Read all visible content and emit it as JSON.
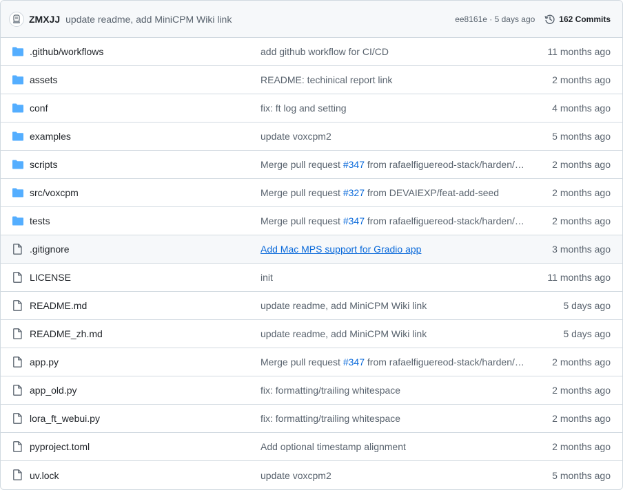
{
  "latest_commit": {
    "author": "ZMXJJ",
    "message": "update readme, add MiniCPM Wiki link",
    "sha_time": "ee8161e · 5 days ago",
    "commits_label": "162 Commits"
  },
  "colors": {
    "folder": "#54aeff",
    "link": "#0969da",
    "muted": "#59636e",
    "border": "#d1d9e0",
    "header_bg": "#f6f8fa"
  },
  "rows": [
    {
      "type": "folder",
      "name": ".github/workflows",
      "msg_pre": "add github workflow for CI/CD",
      "pr": "",
      "msg_post": "",
      "time": "11 months ago"
    },
    {
      "type": "folder",
      "name": "assets",
      "msg_pre": "README: techinical report link",
      "pr": "",
      "msg_post": "",
      "time": "2 months ago"
    },
    {
      "type": "folder",
      "name": "conf",
      "msg_pre": "fix: ft log and setting",
      "pr": "",
      "msg_post": "",
      "time": "4 months ago"
    },
    {
      "type": "folder",
      "name": "examples",
      "msg_pre": "update voxcpm2",
      "pr": "",
      "msg_post": "",
      "time": "5 months ago"
    },
    {
      "type": "folder",
      "name": "scripts",
      "msg_pre": "Merge pull request ",
      "pr": "#347",
      "msg_post": " from rafaelfiguereod-stack/harden/…",
      "time": "2 months ago"
    },
    {
      "type": "folder",
      "name": "src/voxcpm",
      "msg_pre": "Merge pull request ",
      "pr": "#327",
      "msg_post": " from DEVAIEXP/feat-add-seed",
      "time": "2 months ago"
    },
    {
      "type": "folder",
      "name": "tests",
      "msg_pre": "Merge pull request ",
      "pr": "#347",
      "msg_post": " from rafaelfiguereod-stack/harden/…",
      "time": "2 months ago"
    },
    {
      "type": "file",
      "name": ".gitignore",
      "msg_pre": "Add Mac MPS support for Gradio app",
      "pr": "",
      "msg_post": "",
      "time": "3 months ago",
      "hover": true
    },
    {
      "type": "file",
      "name": "LICENSE",
      "msg_pre": "init",
      "pr": "",
      "msg_post": "",
      "time": "11 months ago"
    },
    {
      "type": "file",
      "name": "README.md",
      "msg_pre": "update readme, add MiniCPM Wiki link",
      "pr": "",
      "msg_post": "",
      "time": "5 days ago"
    },
    {
      "type": "file",
      "name": "README_zh.md",
      "msg_pre": "update readme, add MiniCPM Wiki link",
      "pr": "",
      "msg_post": "",
      "time": "5 days ago"
    },
    {
      "type": "file",
      "name": "app.py",
      "msg_pre": "Merge pull request ",
      "pr": "#347",
      "msg_post": " from rafaelfiguereod-stack/harden/…",
      "time": "2 months ago"
    },
    {
      "type": "file",
      "name": "app_old.py",
      "msg_pre": "fix: formatting/trailing whitespace",
      "pr": "",
      "msg_post": "",
      "time": "2 months ago"
    },
    {
      "type": "file",
      "name": "lora_ft_webui.py",
      "msg_pre": "fix: formatting/trailing whitespace",
      "pr": "",
      "msg_post": "",
      "time": "2 months ago"
    },
    {
      "type": "file",
      "name": "pyproject.toml",
      "msg_pre": "Add optional timestamp alignment",
      "pr": "",
      "msg_post": "",
      "time": "2 months ago"
    },
    {
      "type": "file",
      "name": "uv.lock",
      "msg_pre": "update voxcpm2",
      "pr": "",
      "msg_post": "",
      "time": "5 months ago"
    }
  ]
}
